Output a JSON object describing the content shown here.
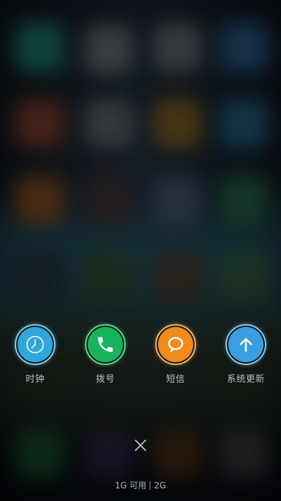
{
  "shortcuts": [
    {
      "label": "时钟",
      "icon": "clock-icon",
      "color": "#2fa6dc",
      "ring": "#7fd0f2"
    },
    {
      "label": "拨号",
      "icon": "phone-icon",
      "color": "#17b35d",
      "ring": "#5bd98e"
    },
    {
      "label": "短信",
      "icon": "message-icon",
      "color": "#f08a1c",
      "ring": "#f6b865"
    },
    {
      "label": "系统更新",
      "icon": "arrow-up-icon",
      "color": "#3a9ee0",
      "ring": "#8cc8f0"
    }
  ],
  "close": {
    "icon": "close-icon"
  },
  "memory": {
    "available": "1G 可用",
    "total": "2G"
  }
}
